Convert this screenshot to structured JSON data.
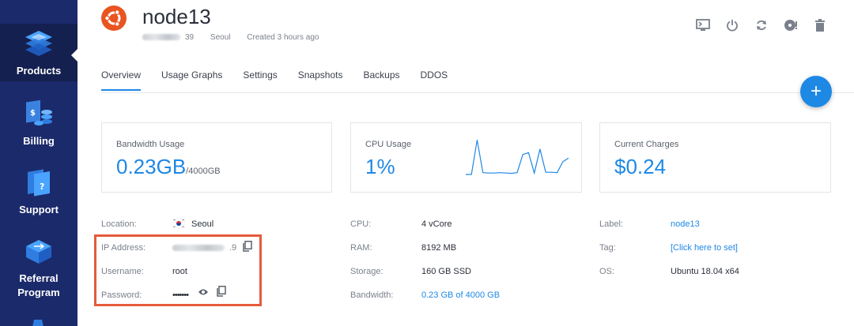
{
  "sidebar": {
    "items": [
      {
        "label": "Products",
        "icon": "layers-icon"
      },
      {
        "label": "Billing",
        "icon": "billing-icon"
      },
      {
        "label": "Support",
        "icon": "support-icon"
      },
      {
        "label": "Referral Program",
        "label_line1": "Referral",
        "label_line2": "Program",
        "icon": "referral-icon"
      }
    ]
  },
  "server": {
    "name": "node13",
    "ip_suffix": "39",
    "location": "Seoul",
    "created": "Created 3 hours ago",
    "os_icon": "ubuntu-logo-icon"
  },
  "toolbar": {
    "icons": [
      "console-icon",
      "power-icon",
      "restart-icon",
      "reinstall-icon",
      "delete-icon"
    ]
  },
  "tabs": [
    "Overview",
    "Usage Graphs",
    "Settings",
    "Snapshots",
    "Backups",
    "DDOS"
  ],
  "active_tab": "Overview",
  "fab_label": "+",
  "cards": {
    "bandwidth": {
      "label": "Bandwidth Usage",
      "value": "0.23GB",
      "suffix": "/4000GB"
    },
    "cpu": {
      "label": "CPU Usage",
      "value": "1%"
    },
    "charges": {
      "label": "Current Charges",
      "value": "$0.24"
    }
  },
  "cpu_sparkline": [
    0,
    0,
    95,
    5,
    4,
    4,
    5,
    4,
    3,
    5,
    55,
    60,
    4,
    70,
    6,
    6,
    5,
    35,
    45
  ],
  "details_left": {
    "location_label": "Location:",
    "location_value": "Seoul",
    "ip_label": "IP Address:",
    "ip_suffix": ".9",
    "username_label": "Username:",
    "username_value": "root",
    "password_label": "Password:",
    "password_value": "•••••••"
  },
  "details_mid": {
    "cpu_label": "CPU:",
    "cpu_value": "4 vCore",
    "ram_label": "RAM:",
    "ram_value": "8192 MB",
    "storage_label": "Storage:",
    "storage_value": "160 GB SSD",
    "bandwidth_label": "Bandwidth:",
    "bandwidth_value": "0.23 GB of 4000 GB"
  },
  "details_right": {
    "label_label": "Label:",
    "label_value": "node13",
    "tag_label": "Tag:",
    "tag_value": "[Click here to set]",
    "os_label": "OS:",
    "os_value": "Ubuntu 18.04 x64"
  },
  "colors": {
    "sidebar": "#1b2a6b",
    "accent": "#1e88e5",
    "highlight": "#e55a3c",
    "ubuntu": "#e95420"
  }
}
